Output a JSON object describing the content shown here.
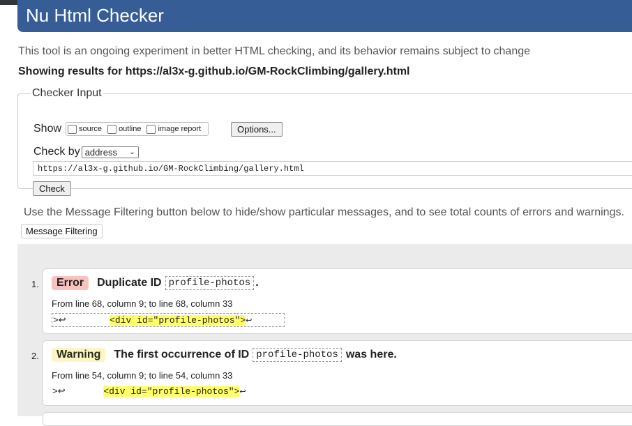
{
  "header": {
    "title": "Nu Html Checker"
  },
  "intro": "This tool is an ongoing experiment in better HTML checking, and its behavior remains subject to change",
  "results_for": "Showing results for https://al3x-g.github.io/GM-RockClimbing/gallery.html",
  "checker_input": {
    "legend": "Checker Input",
    "show_label": "Show",
    "options": [
      "source",
      "outline",
      "image report"
    ],
    "options_button": "Options...",
    "check_by_label": "Check by",
    "check_by_value": "address",
    "url_value": "https://al3x-g.github.io/GM-RockClimbing/gallery.html",
    "check_button": "Check"
  },
  "filter": {
    "description": "Use the Message Filtering button below to hide/show particular messages, and to see total counts of errors and warnings.",
    "button": "Message Filtering"
  },
  "messages": [
    {
      "number": "1.",
      "type": "Error",
      "text_before": "Duplicate ID",
      "code": "profile-photos",
      "text_after": ".",
      "location": "From line 68, column 9; to line 68, column 33",
      "extract_prefix": ">↩        ",
      "extract_highlight": "<div id=\"profile-photos\">",
      "extract_suffix": "↩"
    },
    {
      "number": "2.",
      "type": "Warning",
      "text_before": "The first occurrence of ID",
      "code": "profile-photos",
      "text_after": "was here.",
      "location": "From line 54, column 9; to line 54, column 33",
      "extract_prefix": ">↩       ",
      "extract_highlight": "<div id=\"profile-photos\">",
      "extract_suffix": "↩"
    }
  ]
}
